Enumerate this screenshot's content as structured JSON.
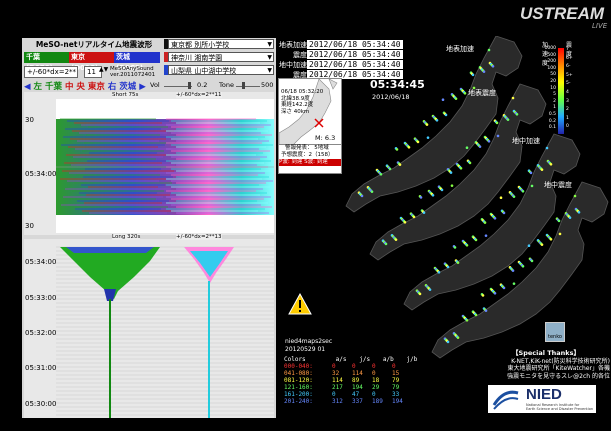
{
  "ustream": {
    "logo": "USTREAM",
    "live": "LIVE"
  },
  "left": {
    "app_title": "MeSO-netリアルタイム地震波形",
    "channels": [
      {
        "label": "千葉 (D078)",
        "color": "#118811"
      },
      {
        "label": "東京 (D00C)",
        "color": "#cc1111"
      },
      {
        "label": "茨城 (D0C3)",
        "color": "#2233cc"
      }
    ],
    "filter_select": "+/-60*dx=2**",
    "gain_select": "11",
    "sound_lines": [
      "MeSOAnySound",
      "ver.2011072401"
    ],
    "stations": [
      {
        "name": "東京都 別所小学校",
        "color": "#111111"
      },
      {
        "name": "神奈川 湘南学園",
        "color": "#cc2222"
      },
      {
        "name": "山梨県 山中湖中学校",
        "color": "#2244cc"
      }
    ],
    "dir_left": "◀",
    "dir_labels": [
      {
        "text": "左 千葉",
        "color": "#118811"
      },
      {
        "text": "中 央 東京",
        "color": "#cc1111"
      },
      {
        "text": "右 茨城",
        "color": "#2233cc"
      }
    ],
    "dir_right": "▶",
    "vol_label": "Vol",
    "vol_value": "0.2",
    "tone_label": "Tone",
    "tone_value": "500",
    "panel1": {
      "header_left": "Short 75s",
      "header_right": "+/-60*dx=2**11",
      "ticks": [
        "30",
        "05:34:00",
        "30"
      ]
    },
    "panel2": {
      "header_left": "Long 320s",
      "header_right": "+/-60*dx=2**13",
      "ticks": [
        "05:34:00",
        "05:33:00",
        "05:32:00",
        "05:31:00",
        "05:30:00"
      ]
    }
  },
  "middle": {
    "date_rows": [
      {
        "label": "地表加速",
        "value": "2012/06/18  05:34:40"
      },
      {
        "label": "震度",
        "value": "2012/06/18  05:34:40"
      },
      {
        "label": "地中加速",
        "value": "2012/06/18  05:34:40"
      },
      {
        "label": "震度",
        "value": "2012/06/18  05:34:40"
      }
    ],
    "quake_info": {
      "datetime": "06/18 05:32:20",
      "lat": "北緯38.9度",
      "lon": "東経142.2度",
      "depth": "深さ 40km",
      "magnitude": "M: 6.3",
      "warn_line1": "警報発表：  5地域",
      "warn_line2": "予想震度：2（158）",
      "p_wave": "P波: 到達",
      "s_wave": "S波: 到達"
    },
    "big_time": "05:34:45",
    "big_date": "2012/06/18",
    "nied4": [
      "nied4maps2sec",
      "20120529 01"
    ],
    "colors_header": [
      "Colors",
      "a/s",
      "j/s",
      "a/b",
      "j/b"
    ],
    "colors_rows": [
      {
        "range": "000-040:",
        "vals": [
          "0",
          "0",
          "0",
          "0"
        ],
        "color": "#ff3333"
      },
      {
        "range": "041-080:",
        "vals": [
          "32",
          "114",
          "0",
          "15"
        ],
        "color": "#ff9944"
      },
      {
        "range": "081-120:",
        "vals": [
          "114",
          "89",
          "18",
          "79"
        ],
        "color": "#ffff44"
      },
      {
        "range": "121-160:",
        "vals": [
          "217",
          "194",
          "29",
          "79"
        ],
        "color": "#66ff66"
      },
      {
        "range": "161-200:",
        "vals": [
          "0",
          "47",
          "0",
          "33"
        ],
        "color": "#44ccff"
      },
      {
        "range": "201-240:",
        "vals": [
          "312",
          "337",
          "189",
          "194"
        ],
        "color": "#6688ff"
      }
    ]
  },
  "right": {
    "map_labels": [
      {
        "text": "地表加速"
      },
      {
        "text": "地表震度"
      },
      {
        "text": "地中加速"
      },
      {
        "text": "地中震度"
      }
    ],
    "legend_titles": [
      "加速度",
      "震度"
    ],
    "legend_accel": [
      "1000",
      "500",
      "200",
      "100",
      "50",
      "20",
      "10",
      "5",
      "2",
      "1",
      "0.5",
      "0.2",
      "0.1"
    ],
    "legend_shindo": [
      "7",
      "6+",
      "6-",
      "5+",
      "5-",
      "4",
      "3",
      "2",
      "1",
      "0"
    ],
    "tenko_label": "tenko",
    "thanks_title": "【Special Thanks】",
    "thanks_lines": [
      "K-NET,KiK-net(防災科学技術研究所)",
      "東大地震研究所「KiteWatcher」各機",
      "強震モニタを見守るスレ@2ch 的各位"
    ],
    "nied_logo": "NIED",
    "nied_sub1": "National Research Institute for",
    "nied_sub2": "Earth Science and Disaster Prevention"
  },
  "accent": {
    "green": "#22aa22",
    "cyan": "#22ddee",
    "warning": "#ffcc00"
  }
}
